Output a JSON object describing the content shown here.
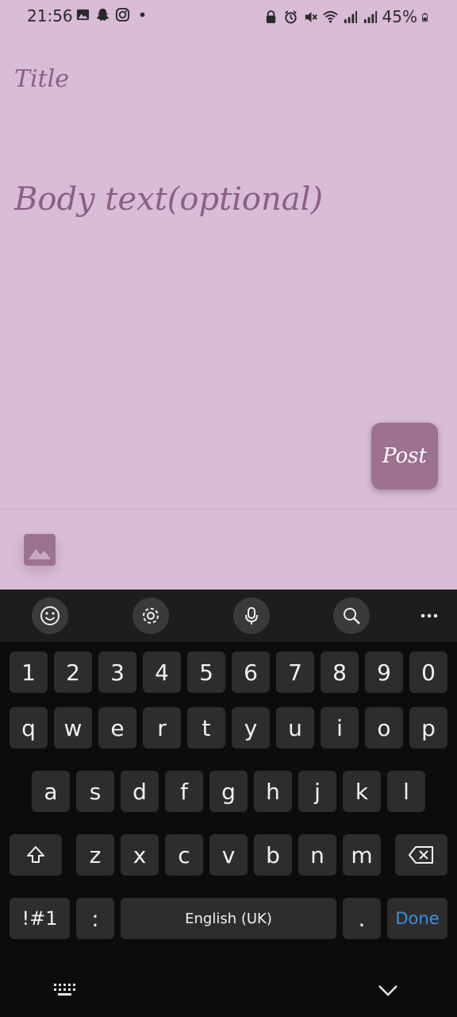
{
  "status_bar": {
    "time": "21:56",
    "battery": "45%",
    "left_icons": [
      "gallery-icon",
      "snapchat-icon",
      "instagram-icon",
      "dot-icon"
    ],
    "right_icons": [
      "lock-icon",
      "alarm-icon",
      "mute-icon",
      "wifi-icon",
      "signal-icon",
      "signal-icon"
    ]
  },
  "editor": {
    "title_placeholder": "Title",
    "body_placeholder": "Body text(optional)"
  },
  "post_button": {
    "label": "Post"
  },
  "colors": {
    "background": "#d9bcd6",
    "accent": "#9d7190",
    "placeholder_text": "#8a5f86",
    "keyboard_bg": "#0c0c0c",
    "key_bg": "#2d2d2d",
    "done_text": "#3e8ed8"
  },
  "keyboard": {
    "toolbar": [
      "emoji-icon",
      "settings-icon",
      "microphone-icon",
      "search-icon",
      "more-icon"
    ],
    "row_numbers": [
      "1",
      "2",
      "3",
      "4",
      "5",
      "6",
      "7",
      "8",
      "9",
      "0"
    ],
    "row_1": [
      "q",
      "w",
      "e",
      "r",
      "t",
      "y",
      "u",
      "i",
      "o",
      "p"
    ],
    "row_2": [
      "a",
      "s",
      "d",
      "f",
      "g",
      "h",
      "j",
      "k",
      "l"
    ],
    "row_3": [
      "z",
      "x",
      "c",
      "v",
      "b",
      "n",
      "m"
    ],
    "symbols_key": "!#1",
    "colon_key": ":",
    "space_label": "English (UK)",
    "period_key": ".",
    "done_label": "Done"
  }
}
